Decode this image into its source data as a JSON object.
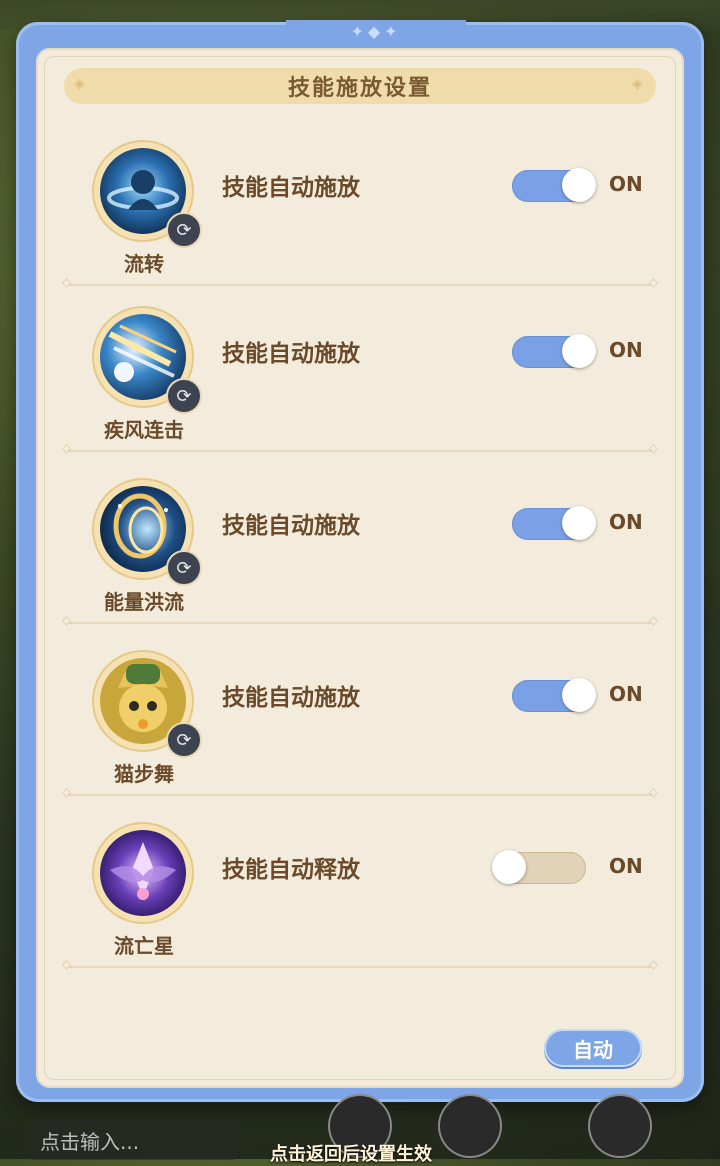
{
  "title": "技能施放设置",
  "skills": [
    {
      "name": "流转",
      "desc": "技能自动施放",
      "toggle": "ON",
      "enabled": true,
      "avatar_icon": "swirl-skill-icon",
      "accent": "#2b6fb0"
    },
    {
      "name": "疾风连击",
      "desc": "技能自动施放",
      "toggle": "ON",
      "enabled": true,
      "avatar_icon": "wind-combo-icon",
      "accent": "#3a86c8"
    },
    {
      "name": "能量洪流",
      "desc": "技能自动施放",
      "toggle": "ON",
      "enabled": true,
      "avatar_icon": "energy-flood-icon",
      "accent": "#1e4f86"
    },
    {
      "name": "猫步舞",
      "desc": "技能自动施放",
      "toggle": "ON",
      "enabled": true,
      "avatar_icon": "cat-dance-icon",
      "accent": "#c9a63c"
    },
    {
      "name": "流亡星",
      "desc": "技能自动释放",
      "toggle": "ON",
      "enabled": false,
      "avatar_icon": "exile-star-icon",
      "accent": "#6a3fb8"
    }
  ],
  "auto_button": "自动",
  "bottom": {
    "input_placeholder": "点击输入...",
    "hint": "点击返回后设置生效"
  },
  "colors": {
    "frame": "#7ea6e6",
    "panel": "#f3ecdc",
    "title_bar": "#f0dcaa",
    "text_brown": "#6a4a2a",
    "toggle_on": "#7aa0e6",
    "toggle_off": "#e1d2b8"
  }
}
